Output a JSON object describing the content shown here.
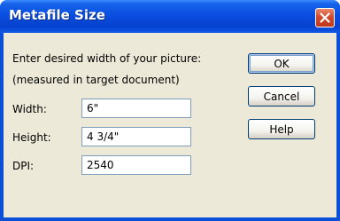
{
  "window": {
    "title": "Metafile Size",
    "close_icon": "close-icon",
    "accent": "#0a4fd6",
    "close_color": "#d4492c",
    "face_color": "#ece9d8"
  },
  "content": {
    "instruction_line1": "Enter desired width of your picture:",
    "instruction_line2": "(measured in target document)"
  },
  "fields": {
    "width": {
      "label": "Width:",
      "value": "6\""
    },
    "height": {
      "label": "Height:",
      "value": "4 3/4\""
    },
    "dpi": {
      "label": "DPI:",
      "value": "2540"
    }
  },
  "buttons": {
    "ok": "OK",
    "cancel": "Cancel",
    "help": "Help"
  }
}
